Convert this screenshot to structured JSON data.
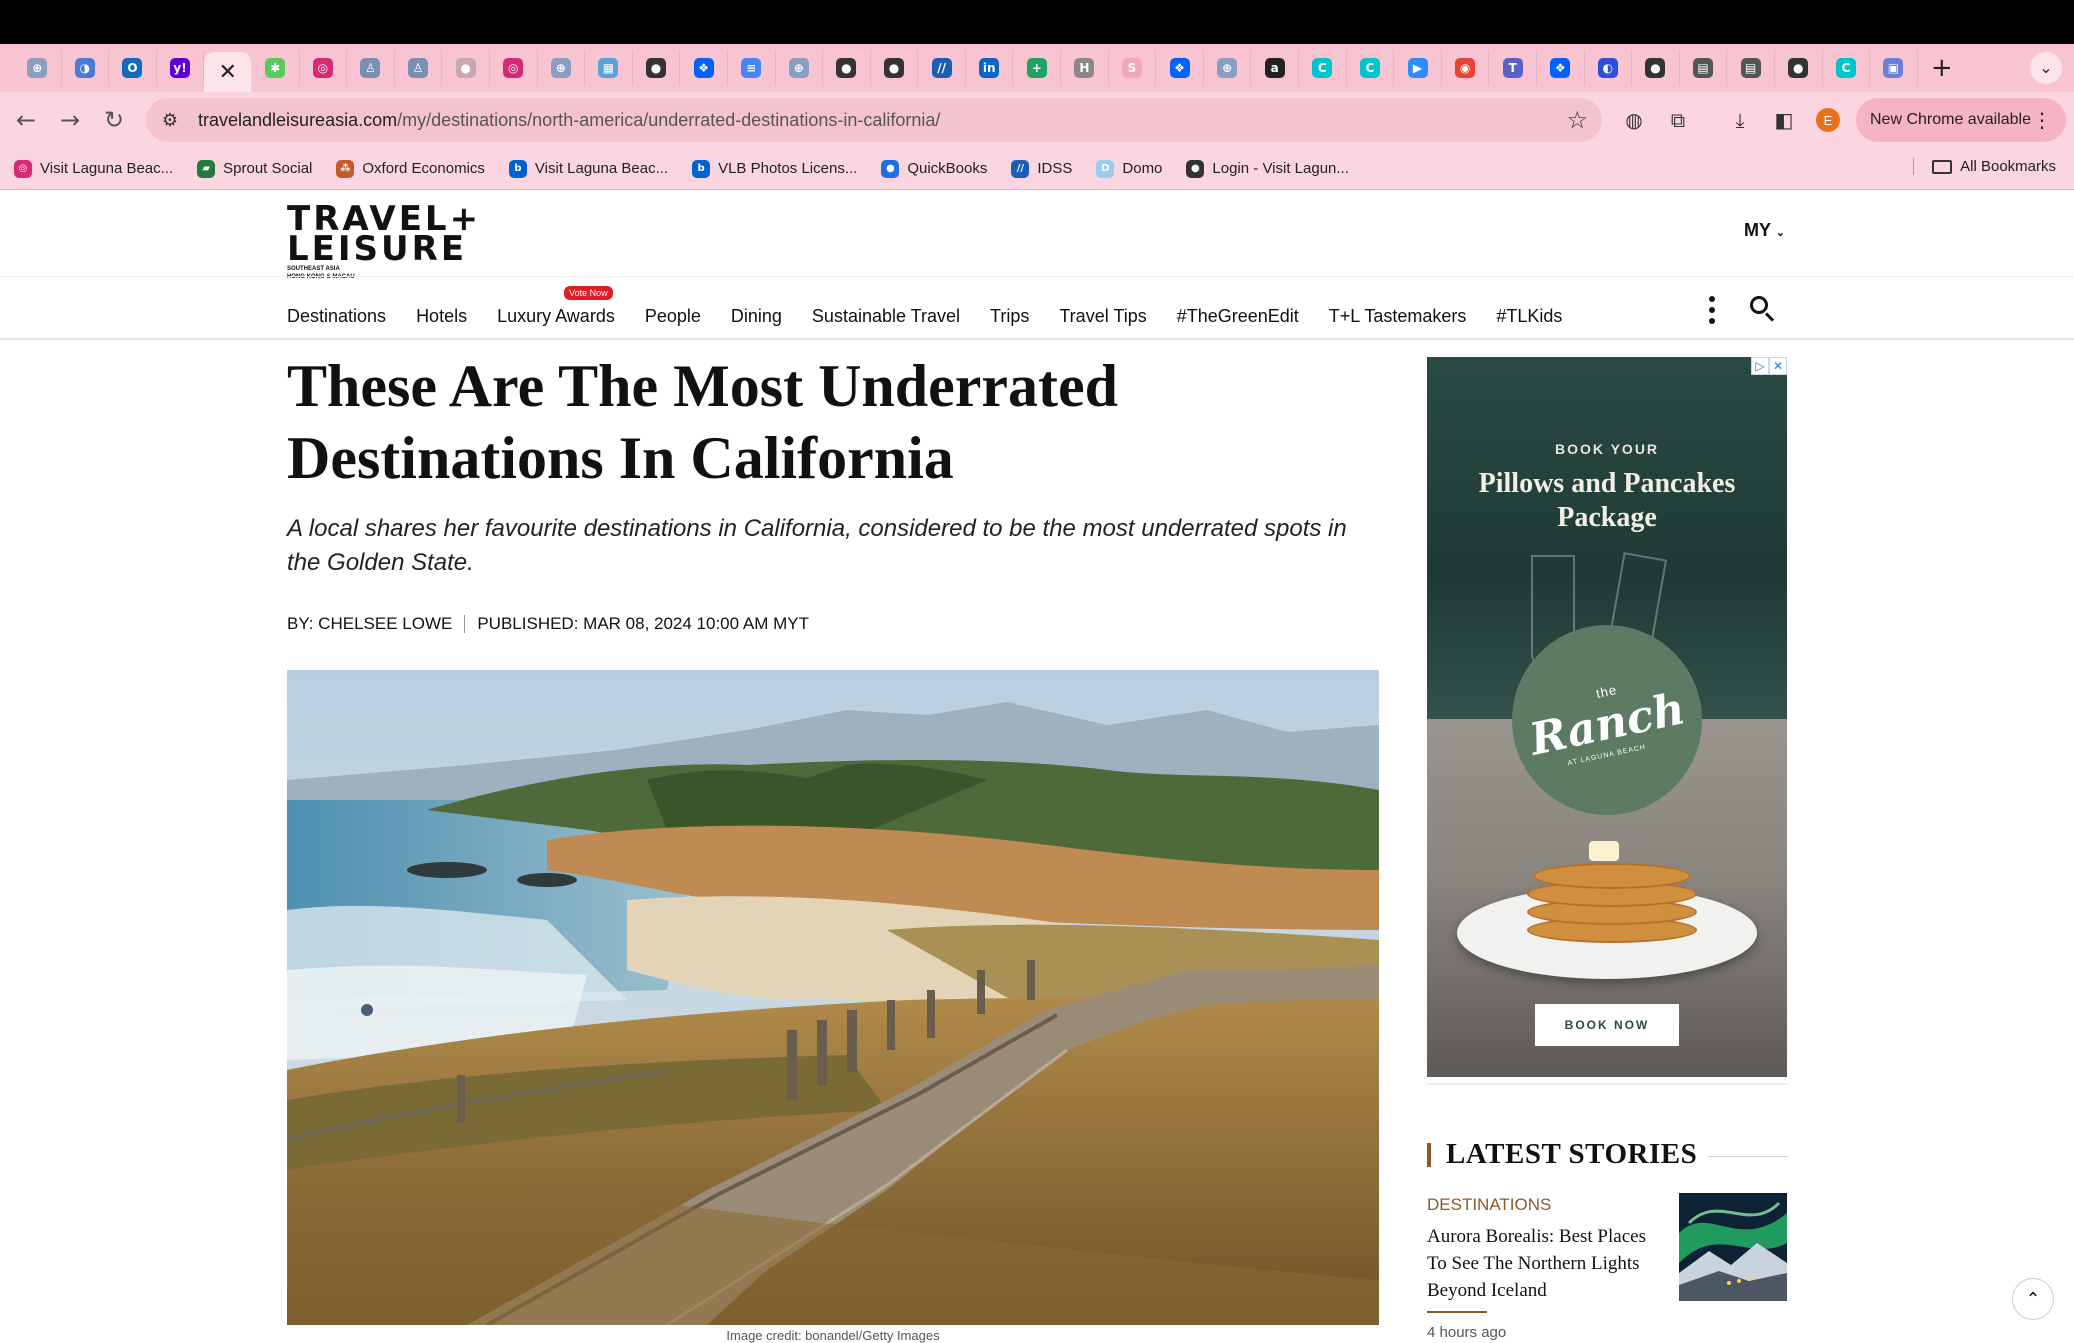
{
  "browser": {
    "tabs": [
      {
        "icon": "globe-icon",
        "color": "#8b9dc3",
        "glyph": "⊕"
      },
      {
        "icon": "colorful-circle-icon",
        "color": "#4a7bd4",
        "glyph": "◑"
      },
      {
        "icon": "outlook-icon",
        "color": "#0f6cbd",
        "glyph": "O"
      },
      {
        "icon": "yahoo-icon",
        "color": "#6001d2",
        "glyph": "y!"
      },
      {
        "icon": "close-icon",
        "active": true
      },
      {
        "icon": "sprout-icon",
        "color": "#59cb59",
        "glyph": "✱"
      },
      {
        "icon": "instagram-icon",
        "color": "#d62976",
        "glyph": "◎"
      },
      {
        "icon": "person-icon",
        "color": "#7b8fb3",
        "glyph": "♙"
      },
      {
        "icon": "person-icon",
        "color": "#7b8fb3",
        "glyph": "♙"
      },
      {
        "icon": "circle-icon",
        "color": "#c9a7b0",
        "glyph": "●"
      },
      {
        "icon": "instagram-icon",
        "color": "#d62976",
        "glyph": "◎"
      },
      {
        "icon": "globe-icon",
        "color": "#8b9dc3",
        "glyph": "⊕"
      },
      {
        "icon": "map-icon",
        "color": "#5aa2d8",
        "glyph": "▦"
      },
      {
        "icon": "dark-circle-icon",
        "color": "#333333",
        "glyph": "●"
      },
      {
        "icon": "dropbox-icon",
        "color": "#0061fe",
        "glyph": "❖"
      },
      {
        "icon": "docs-icon",
        "color": "#4285f4",
        "glyph": "≡"
      },
      {
        "icon": "globe-icon",
        "color": "#8b9dc3",
        "glyph": "⊕"
      },
      {
        "icon": "dark-circle-icon",
        "color": "#333333",
        "glyph": "●"
      },
      {
        "icon": "dark-circle-icon",
        "color": "#333333",
        "glyph": "●"
      },
      {
        "icon": "slash-icon",
        "color": "#1a5fb4",
        "glyph": "//"
      },
      {
        "icon": "linkedin-icon",
        "color": "#0a66c2",
        "glyph": "in"
      },
      {
        "icon": "sheets-plus-icon",
        "color": "#1ea362",
        "glyph": "+"
      },
      {
        "icon": "h-icon",
        "color": "#888888",
        "glyph": "H"
      },
      {
        "icon": "s-icon",
        "color": "#f2a7b7",
        "glyph": "S"
      },
      {
        "icon": "dropbox-icon",
        "color": "#0061fe",
        "glyph": "❖"
      },
      {
        "icon": "globe-icon",
        "color": "#8b9dc3",
        "glyph": "⊕"
      },
      {
        "icon": "amazon-icon",
        "color": "#222222",
        "glyph": "a"
      },
      {
        "icon": "canva-icon",
        "color": "#00c4cc",
        "glyph": "C"
      },
      {
        "icon": "canva-icon",
        "color": "#00c4cc",
        "glyph": "C"
      },
      {
        "icon": "video-icon",
        "color": "#2d8cff",
        "glyph": "▶"
      },
      {
        "icon": "chrome-icon",
        "color": "#e94235",
        "glyph": "◉"
      },
      {
        "icon": "teams-icon",
        "color": "#5b5fc7",
        "glyph": "T"
      },
      {
        "icon": "dropbox-icon",
        "color": "#0061fe",
        "glyph": "❖"
      },
      {
        "icon": "blue-circle-icon",
        "color": "#2f4fd8",
        "glyph": "◐"
      },
      {
        "icon": "dark-circle-icon",
        "color": "#333333",
        "glyph": "●"
      },
      {
        "icon": "document-icon",
        "color": "#555555",
        "glyph": "▤"
      },
      {
        "icon": "document-icon",
        "color": "#555555",
        "glyph": "▤"
      },
      {
        "icon": "dark-circle-icon",
        "color": "#333333",
        "glyph": "●"
      },
      {
        "icon": "canva-icon",
        "color": "#00c4cc",
        "glyph": "C"
      },
      {
        "icon": "printer-icon",
        "color": "#6b7fd8",
        "glyph": "▣"
      }
    ],
    "url_domain": "travelandleisureasia.com",
    "url_path": "/my/destinations/north-america/underrated-destinations-in-california/",
    "profile_initial": "E",
    "new_chrome_label": "New Chrome available",
    "bookmarks": [
      {
        "label": "Visit Laguna Beac...",
        "icon": "instagram-icon",
        "color": "#d62976",
        "glyph": "◎"
      },
      {
        "label": "Sprout Social",
        "icon": "sprout-icon",
        "color": "#1e7d3a",
        "glyph": "▰"
      },
      {
        "label": "Oxford Economics",
        "icon": "dots-icon",
        "color": "#c45a2a",
        "glyph": "⁂"
      },
      {
        "label": "Visit Laguna Beac...",
        "icon": "box-icon",
        "color": "#0061d5",
        "glyph": "b"
      },
      {
        "label": "VLB Photos Licens...",
        "icon": "box-icon",
        "color": "#0061d5",
        "glyph": "b"
      },
      {
        "label": "QuickBooks",
        "icon": "quickbooks-icon",
        "color": "#1f6fe0",
        "glyph": "●"
      },
      {
        "label": "IDSS",
        "icon": "slash-icon",
        "color": "#1a5fb4",
        "glyph": "//"
      },
      {
        "label": "Domo",
        "icon": "domo-icon",
        "color": "#99ccee",
        "glyph": "D"
      },
      {
        "label": "Login - Visit Lagun...",
        "icon": "dark-circle-icon",
        "color": "#333333",
        "glyph": "●"
      }
    ],
    "all_bookmarks_label": "All Bookmarks"
  },
  "site": {
    "logo_line1": "TRAVEL+",
    "logo_line2": "LEISURE",
    "logo_sub1": "SOUTHEAST ASIA",
    "logo_sub2": "HONG KONG & MACAU",
    "region": "MY",
    "nav": [
      "Destinations",
      "Hotels",
      "Luxury Awards",
      "People",
      "Dining",
      "Sustainable Travel",
      "Trips",
      "Travel Tips",
      "#TheGreenEdit",
      "T+L Tastemakers",
      "#TLKids"
    ],
    "vote_badge": "Vote Now"
  },
  "article": {
    "headline": "These Are The Most Underrated Destinations In California",
    "dek": "A local shares her favourite destinations in California, considered to be the most underrated spots in the Golden State.",
    "byline": "BY: CHELSEE LOWE",
    "published": "PUBLISHED: MAR 08, 2024 10:00 AM MYT",
    "image_credit": "Image credit: bonandel/Getty Images"
  },
  "ad": {
    "kicker": "BOOK YOUR",
    "title": "Pillows and Pancakes Package",
    "brand_prefix": "the",
    "brand": "Ranch",
    "brand_sub": "AT LAGUNA BEACH",
    "button": "BOOK NOW"
  },
  "sidebar": {
    "latest_title": "LATEST STORIES",
    "story": {
      "category": "DESTINATIONS",
      "title": "Aurora Borealis: Best Places To See The Northern Lights Beyond Iceland",
      "time": "4 hours ago"
    }
  }
}
